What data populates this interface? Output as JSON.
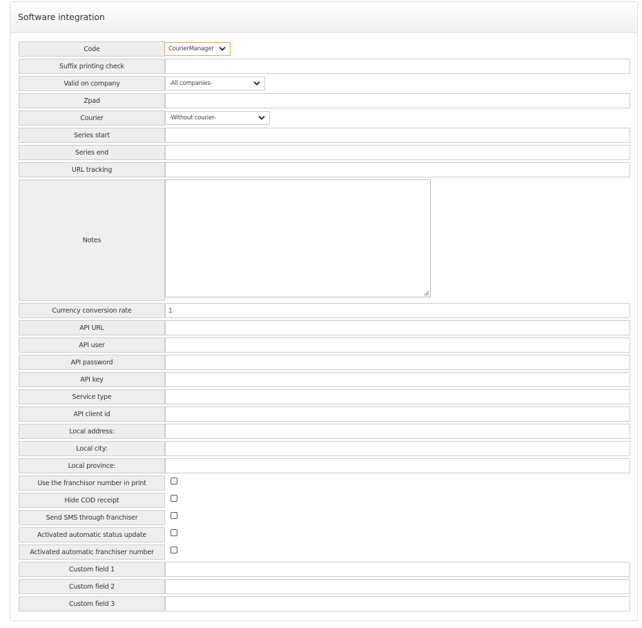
{
  "panel": {
    "title": "Software integration"
  },
  "form": {
    "code": {
      "label": "Code",
      "value": "CourierManager"
    },
    "suffix_printing_check": {
      "label": "Suffix printing check",
      "value": ""
    },
    "valid_on_company": {
      "label": "Valid on company",
      "value": "-All companies-"
    },
    "zpad": {
      "label": "Zpad",
      "value": ""
    },
    "courier": {
      "label": "Courier",
      "value": "-Without courier-"
    },
    "series_start": {
      "label": "Series start",
      "value": ""
    },
    "series_end": {
      "label": "Series end",
      "value": ""
    },
    "url_tracking": {
      "label": "URL tracking",
      "value": ""
    },
    "notes": {
      "label": "Notes",
      "value": ""
    },
    "currency_conversion_rate": {
      "label": "Currency conversion rate",
      "value": "1"
    },
    "api_url": {
      "label": "API URL",
      "value": ""
    },
    "api_user": {
      "label": "API user",
      "value": ""
    },
    "api_password": {
      "label": "API password",
      "value": ""
    },
    "api_key": {
      "label": "API key",
      "value": ""
    },
    "service_type": {
      "label": "Service type",
      "value": ""
    },
    "api_client_id": {
      "label": "API client id",
      "value": ""
    },
    "local_address": {
      "label": "Local address:",
      "value": ""
    },
    "local_city": {
      "label": "Local city:",
      "value": ""
    },
    "local_province": {
      "label": "Local province:",
      "value": ""
    },
    "use_franchisor_number": {
      "label": "Use the franchisor number in print",
      "checked": false
    },
    "hide_cod_receipt": {
      "label": "Hide COD receipt",
      "checked": false
    },
    "send_sms_franchiser": {
      "label": "Send SMS through franchiser",
      "checked": false
    },
    "auto_status_update": {
      "label": "Activated automatic status update",
      "checked": false
    },
    "auto_franchiser_number": {
      "label": "Activated automatic franchiser number",
      "checked": false
    },
    "custom_field_1": {
      "label": "Custom field 1",
      "value": ""
    },
    "custom_field_2": {
      "label": "Custom field 2",
      "value": ""
    },
    "custom_field_3": {
      "label": "Custom field 3",
      "value": ""
    }
  },
  "icons": {
    "select_arrow": "chevron-down-icon",
    "textarea_resize": "resize-grip-icon"
  },
  "colors": {
    "focus_border": "#e8a64c",
    "label_bg": "#eeeeee",
    "border": "#cccccc"
  }
}
